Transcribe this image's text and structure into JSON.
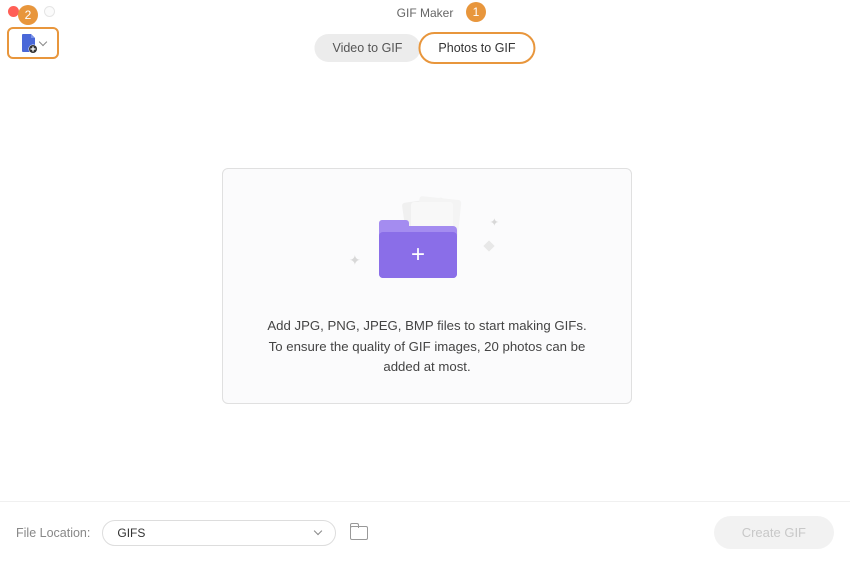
{
  "window": {
    "title": "GIF Maker"
  },
  "annotations": {
    "badge1": "1",
    "badge2": "2"
  },
  "tabs": {
    "video": "Video to GIF",
    "photos": "Photos to GIF"
  },
  "dropzone": {
    "text": "Add JPG, PNG, JPEG, BMP files to start making GIFs. To ensure the quality of GIF images, 20 photos can be added at most."
  },
  "footer": {
    "label": "File Location:",
    "selected": "GIFS",
    "create": "Create GIF"
  },
  "colors": {
    "accent": "#e8963c",
    "folder": "#8a6ee8"
  }
}
